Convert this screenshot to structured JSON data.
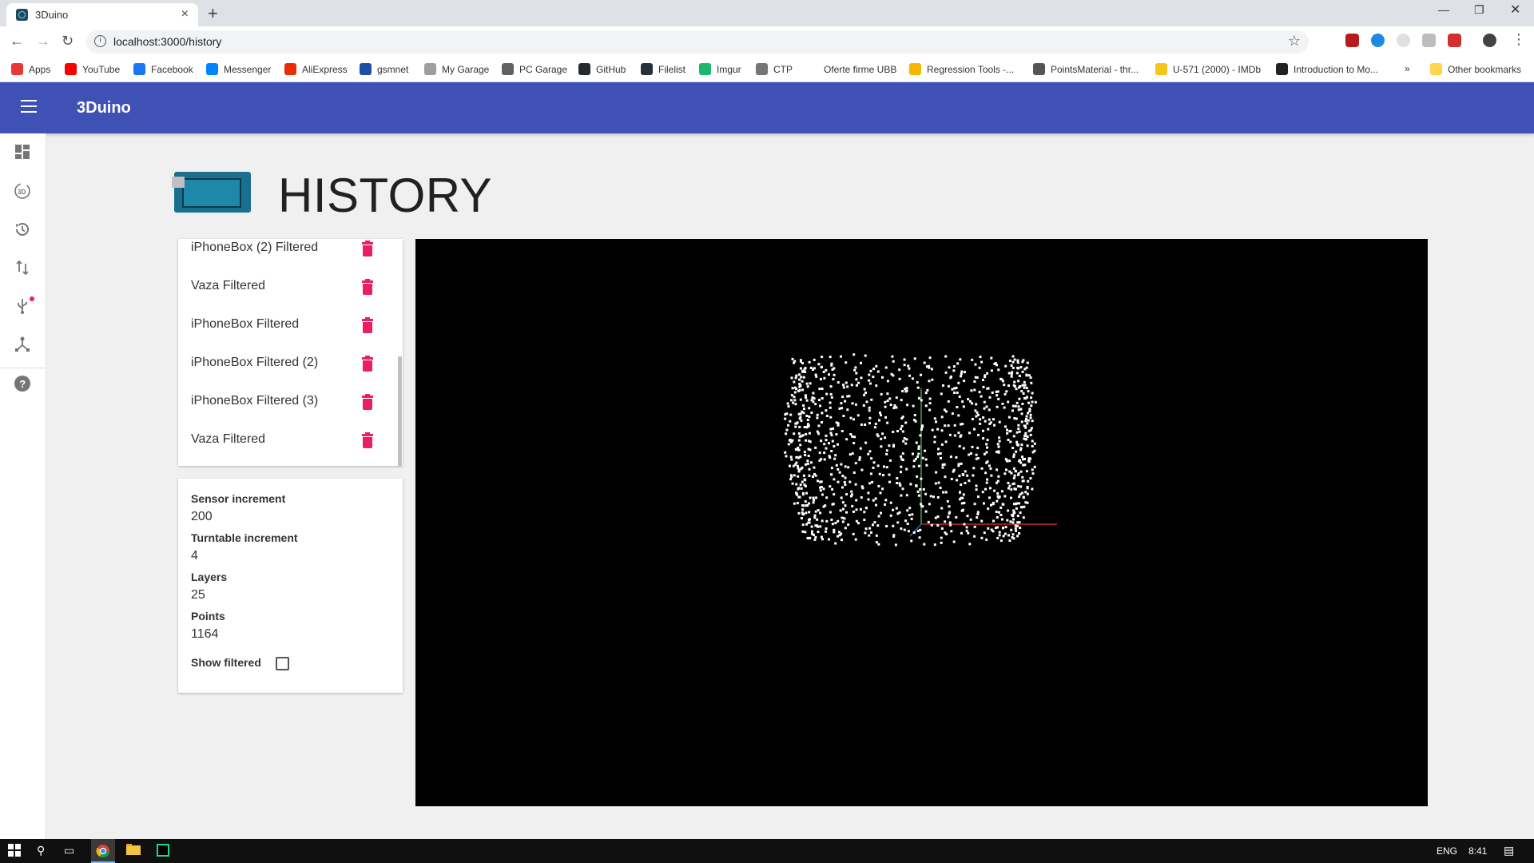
{
  "browser": {
    "tab_title": "3Duino",
    "url": "localhost:3000/history",
    "bookmarks": [
      {
        "label": "Apps",
        "color": "#e53935"
      },
      {
        "label": "YouTube",
        "color": "#ff0000"
      },
      {
        "label": "Facebook",
        "color": "#1877f2"
      },
      {
        "label": "Messenger",
        "color": "#0084ff"
      },
      {
        "label": "AliExpress",
        "color": "#e62e04"
      },
      {
        "label": "gsmnet",
        "color": "#1e4fa3"
      },
      {
        "label": "My Garage",
        "color": "#9e9e9e"
      },
      {
        "label": "PC Garage",
        "color": "#616161"
      },
      {
        "label": "GitHub",
        "color": "#24292e"
      },
      {
        "label": "Filelist",
        "color": "#263238"
      },
      {
        "label": "Imgur",
        "color": "#1bb76e"
      },
      {
        "label": "CTP",
        "color": "#757575"
      },
      {
        "label": "Oferte firme UBB",
        "color": "#ffffff"
      },
      {
        "label": "Regression Tools -...",
        "color": "#f7b500"
      },
      {
        "label": "PointsMaterial - thr...",
        "color": "#555555"
      },
      {
        "label": "U-571 (2000) - IMDb",
        "color": "#f5c518"
      },
      {
        "label": "Introduction to Mo...",
        "color": "#222222"
      },
      {
        "label": "»",
        "color": "#ffffff"
      },
      {
        "label": "Other bookmarks",
        "color": "#ffd54f"
      }
    ]
  },
  "app": {
    "title": "3Duino",
    "nav_icons": [
      "dashboard-icon",
      "3d-rotation-icon",
      "history-icon",
      "import-export-icon",
      "usb-icon",
      "device-hub-icon",
      "help-icon"
    ]
  },
  "page": {
    "title": "HISTORY"
  },
  "history": {
    "items": [
      {
        "label": "iPhoneBox (2) Filtered"
      },
      {
        "label": "Vaza Filtered"
      },
      {
        "label": "iPhoneBox Filtered"
      },
      {
        "label": "iPhoneBox Filtered (2)"
      },
      {
        "label": "iPhoneBox Filtered (3)"
      },
      {
        "label": "Vaza Filtered"
      }
    ]
  },
  "info": {
    "sensor_increment_label": "Sensor increment",
    "sensor_increment_value": "200",
    "turntable_increment_label": "Turntable increment",
    "turntable_increment_value": "4",
    "layers_label": "Layers",
    "layers_value": "25",
    "points_label": "Points",
    "points_value": "1164",
    "show_filtered_label": "Show filtered",
    "show_filtered_checked": false
  },
  "colors": {
    "primary": "#3f51b5",
    "accent": "#e91e63",
    "viewer_background": "#000000"
  },
  "taskbar": {
    "language": "ENG",
    "time": "8:41"
  }
}
